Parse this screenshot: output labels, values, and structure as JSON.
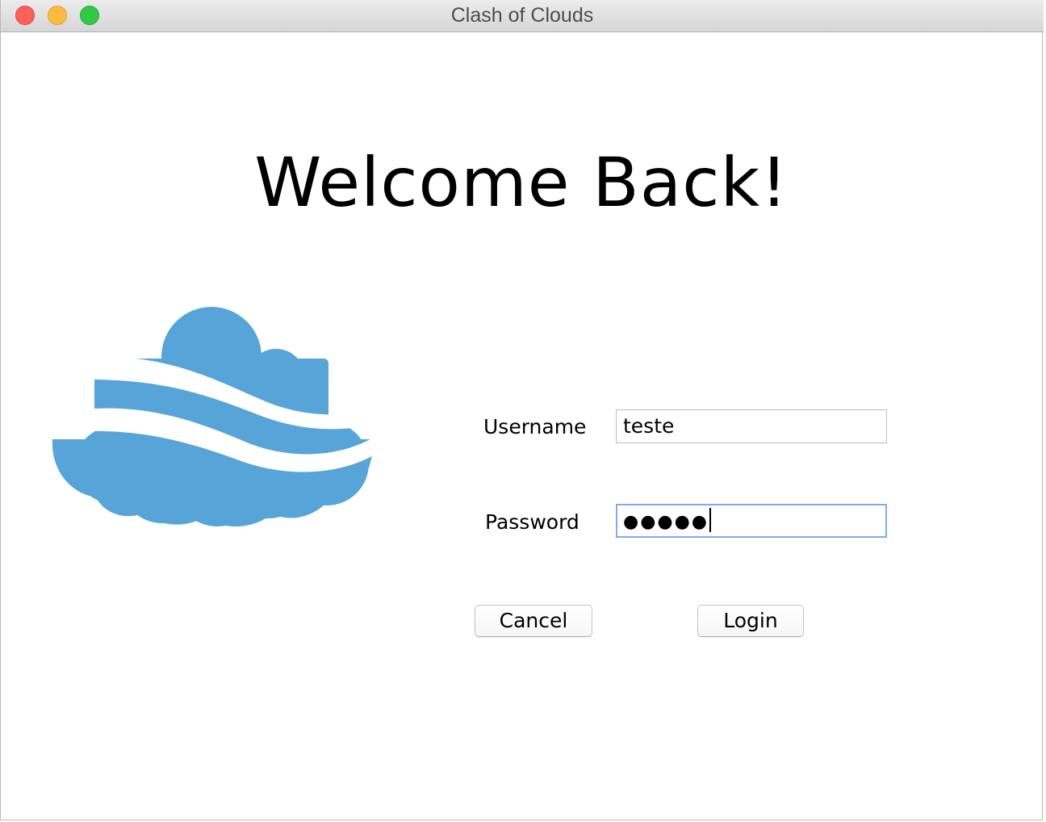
{
  "window": {
    "title": "Clash of Clouds"
  },
  "main": {
    "heading": "Welcome Back!",
    "logo_icon": "cloud-logo-icon",
    "logo_color": "#57a4d8",
    "username": {
      "label": "Username",
      "value": "teste"
    },
    "password": {
      "label": "Password",
      "masked_value": "●●●●●"
    },
    "buttons": {
      "cancel": "Cancel",
      "login": "Login"
    }
  }
}
